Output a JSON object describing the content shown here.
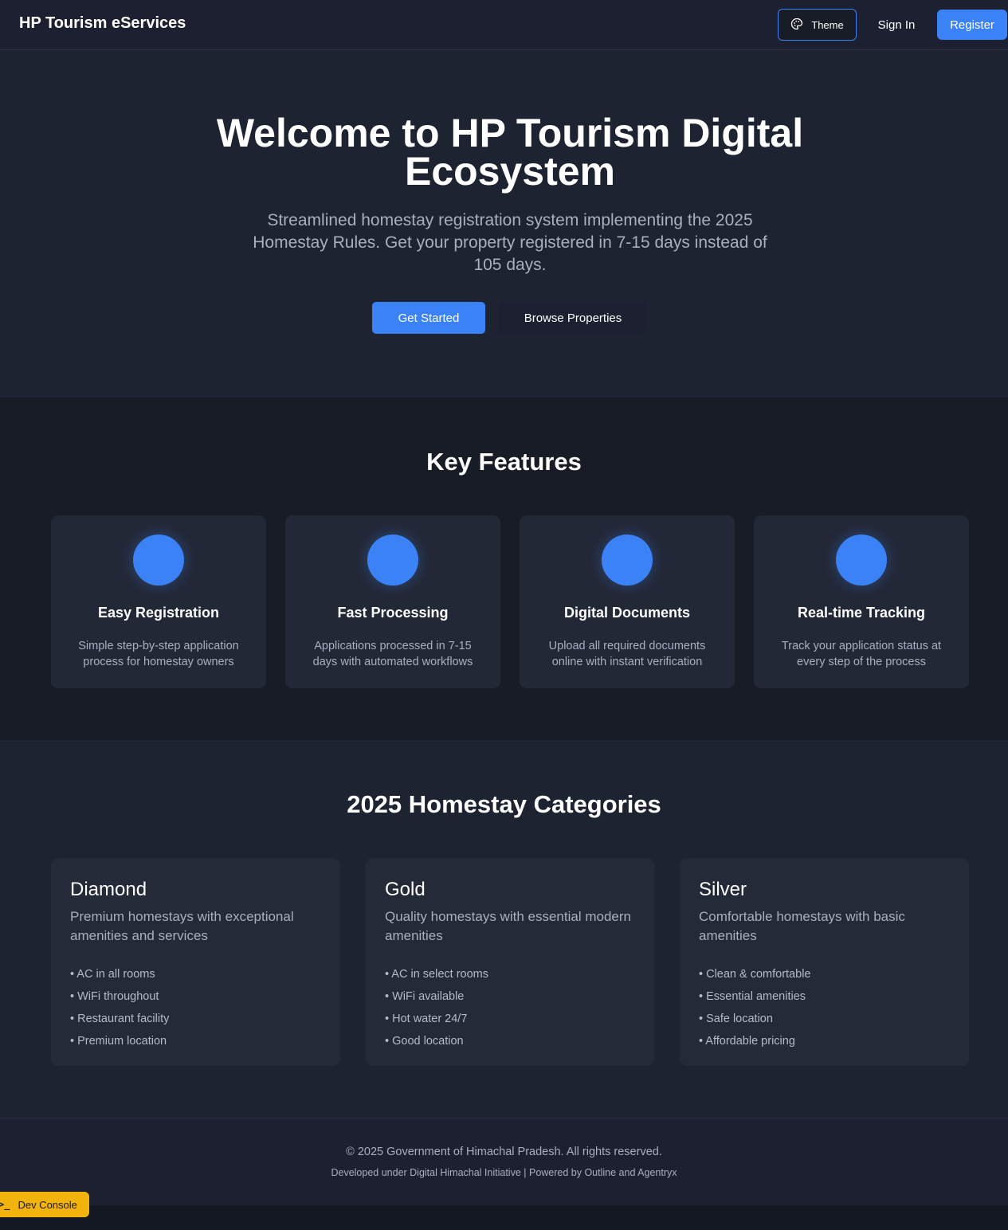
{
  "header": {
    "brand": "HP Tourism eServices",
    "theme_label": "Theme",
    "sign_in_label": "Sign In",
    "register_label": "Register"
  },
  "hero": {
    "title": "Welcome to HP Tourism Digital Ecosystem",
    "subtitle": "Streamlined homestay registration system implementing the 2025 Homestay Rules. Get your property registered in 7-15 days instead of 105 days.",
    "primary_cta": "Get Started",
    "secondary_cta": "Browse Properties"
  },
  "features": {
    "title": "Key Features",
    "items": [
      {
        "title": "Easy Registration",
        "description": "Simple step-by-step application process for homestay owners"
      },
      {
        "title": "Fast Processing",
        "description": "Applications processed in 7-15 days with automated workflows"
      },
      {
        "title": "Digital Documents",
        "description": "Upload all required documents online with instant verification"
      },
      {
        "title": "Real-time Tracking",
        "description": "Track your application status at every step of the process"
      }
    ]
  },
  "categories": {
    "title": "2025 Homestay Categories",
    "items": [
      {
        "title": "Diamond",
        "description": "Premium homestays with exceptional amenities and services",
        "features": [
          "• AC in all rooms",
          "• WiFi throughout",
          "• Restaurant facility",
          "• Premium location"
        ]
      },
      {
        "title": "Gold",
        "description": "Quality homestays with essential modern amenities",
        "features": [
          "• AC in select rooms",
          "• WiFi available",
          "• Hot water 24/7",
          "• Good location"
        ]
      },
      {
        "title": "Silver",
        "description": "Comfortable homestays with basic amenities",
        "features": [
          "• Clean & comfortable",
          "• Essential amenities",
          "• Safe location",
          "• Affordable pricing"
        ]
      }
    ]
  },
  "footer": {
    "copyright": "© 2025 Government of Himachal Pradesh. All rights reserved.",
    "developed": "Developed under Digital Himachal Initiative | Powered by Outline and Agentryx"
  },
  "dev_console": {
    "icon": ">_",
    "label": "Dev Console"
  },
  "colors": {
    "accent": "#3b82f6",
    "background": "#181c26",
    "dev_console": "#f3b30d"
  },
  "icons": {
    "theme": "palette-icon",
    "dev_console": "terminal-icon"
  }
}
